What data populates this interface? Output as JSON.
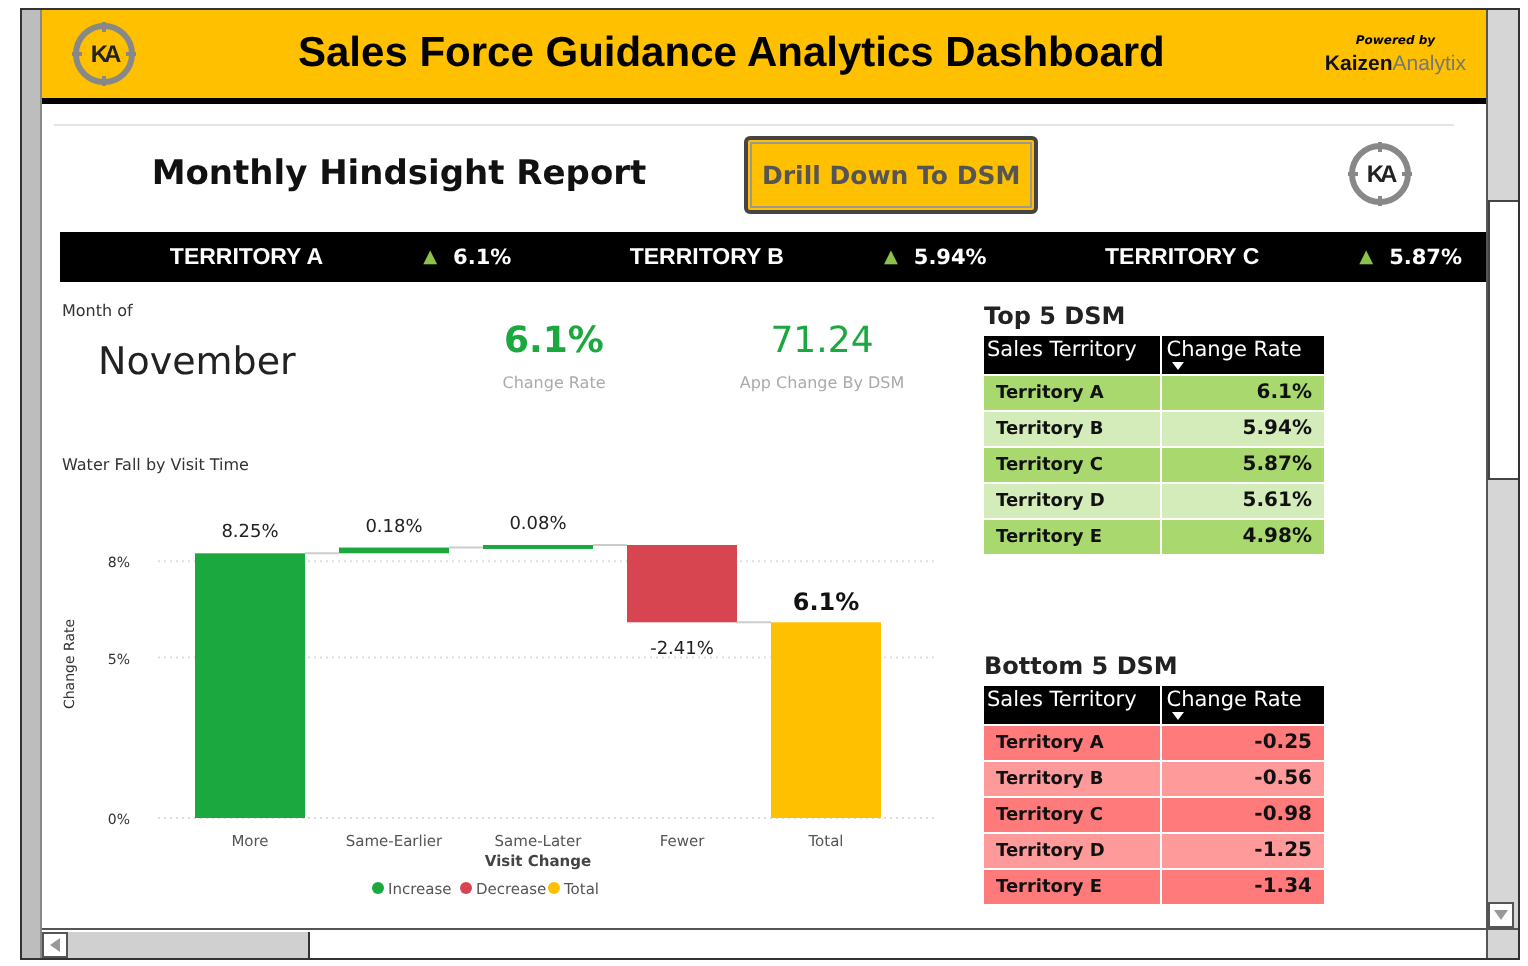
{
  "header": {
    "logo_text": "KA",
    "title": "Sales Force Guidance Analytics Dashboard",
    "powered_by": "Powered by",
    "brand_dark": "Kaizen",
    "brand_light": "Analytix"
  },
  "report": {
    "title": "Monthly Hindsight Report",
    "button": "Drill Down To DSM",
    "logo_text": "KA"
  },
  "ticker": [
    {
      "name": "TERRITORY A",
      "arrow": "▲",
      "value": "6.1%"
    },
    {
      "name": "TERRITORY B",
      "arrow": "▲",
      "value": "5.94%"
    },
    {
      "name": "TERRITORY C",
      "arrow": "▲",
      "value": "5.87%"
    }
  ],
  "kpis": {
    "month_label": "Month of",
    "month": "November",
    "change_rate": {
      "value": "6.1%",
      "label": "Change Rate"
    },
    "app_change": {
      "value": "71.24",
      "label": "App Change By DSM"
    }
  },
  "waterfall": {
    "title": "Water Fall by Visit Time",
    "xlabel": "Visit Change",
    "ylabel": "Change Rate",
    "ytick_labels": [
      "8%",
      "5%",
      "0%"
    ],
    "bars": [
      {
        "category": "More",
        "label": "8.25%",
        "kind": "increase"
      },
      {
        "category": "Same-Earlier",
        "label": "0.18%",
        "kind": "increase"
      },
      {
        "category": "Same-Later",
        "label": "0.08%",
        "kind": "increase"
      },
      {
        "category": "Fewer",
        "label": "-2.41%",
        "kind": "decrease"
      },
      {
        "category": "Total",
        "label": "6.1%",
        "kind": "total"
      }
    ],
    "legend": [
      {
        "label": "Increase",
        "color": "#1aa83f"
      },
      {
        "label": "Decrease",
        "color": "#d64550"
      },
      {
        "label": "Total",
        "color": "#ffc000"
      }
    ]
  },
  "top_table": {
    "title": "Top 5 DSM",
    "columns": [
      "Sales Territory",
      "Change Rate"
    ],
    "rows": [
      [
        "Territory A",
        "6.1%"
      ],
      [
        "Territory B",
        "5.94%"
      ],
      [
        "Territory C",
        "5.87%"
      ],
      [
        "Territory D",
        "5.61%"
      ],
      [
        "Territory E",
        "4.98%"
      ]
    ]
  },
  "bottom_table": {
    "title": "Bottom 5 DSM",
    "columns": [
      "Sales Territory",
      "Change Rate"
    ],
    "rows": [
      [
        "Territory A",
        "-0.25"
      ],
      [
        "Territory B",
        "-0.56"
      ],
      [
        "Territory C",
        "-0.98"
      ],
      [
        "Territory D",
        "-1.25"
      ],
      [
        "Territory E",
        "-1.34"
      ]
    ]
  }
}
